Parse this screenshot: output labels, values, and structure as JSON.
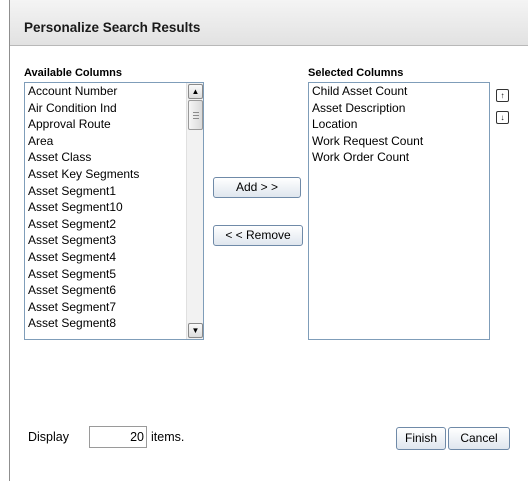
{
  "dialog": {
    "title": "Personalize Search Results"
  },
  "available": {
    "label": "Available Columns",
    "items": [
      "Account Number",
      "Air Condition Ind",
      "Approval Route",
      "Area",
      "Asset Class",
      "Asset Key Segments",
      "Asset Segment1",
      "Asset Segment10",
      "Asset Segment2",
      "Asset Segment3",
      "Asset Segment4",
      "Asset Segment5",
      "Asset Segment6",
      "Asset Segment7",
      "Asset Segment8"
    ],
    "scroll_up_icon": "▲",
    "scroll_down_icon": "▼"
  },
  "selected": {
    "label": "Selected Columns",
    "items": [
      "Child Asset Count",
      "Asset Description",
      "Location",
      "Work Request Count",
      "Work Order Count"
    ],
    "move_up_icon": "↑",
    "move_down_icon": "↓"
  },
  "actions": {
    "add_label": "Add > >",
    "remove_label": "< < Remove"
  },
  "footer": {
    "display_label": "Display",
    "display_value": "20",
    "items_label": "items.",
    "finish_label": "Finish",
    "cancel_label": "Cancel"
  }
}
